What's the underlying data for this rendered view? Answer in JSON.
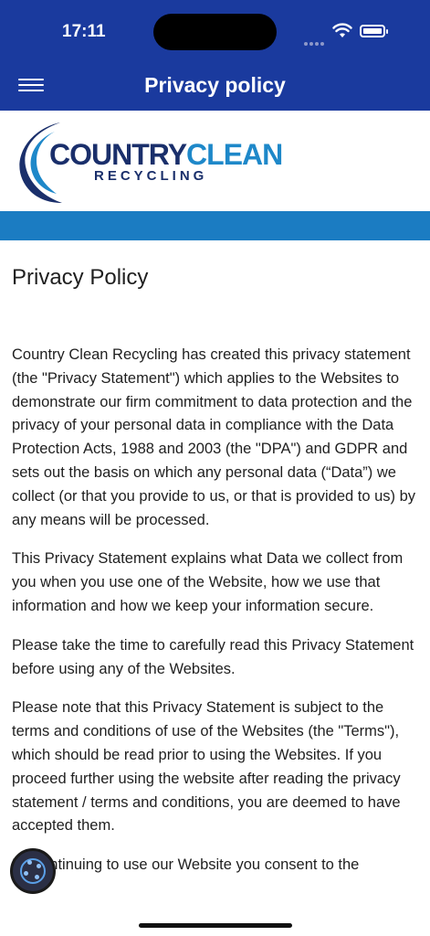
{
  "status_bar": {
    "time": "17:11"
  },
  "header": {
    "title": "Privacy policy"
  },
  "logo": {
    "word1": "COUNTRY",
    "word2": "CLEAN",
    "sub": "RECYCLING"
  },
  "colors": {
    "header": "#1a3a9e",
    "accent_bar": "#1b7cc2",
    "logo_dark": "#1a2f6b",
    "logo_light": "#1e88c9"
  },
  "content": {
    "heading": "Privacy Policy",
    "paragraphs": [
      "Country Clean Recycling has created this privacy statement (the \"Privacy Statement\") which applies to the Websites to demonstrate our firm commitment to data protection and the privacy of your personal data in compliance with the Data Protection Acts, 1988 and 2003 (the \"DPA\") and GDPR and sets out the basis on which any personal data (“Data”) we collect (or that you provide to us, or that is provided to us) by any means will be processed.",
      "This Privacy Statement explains what Data we collect from you when you use one of the Website, how we use that information and how we keep your information secure.",
      "Please take the time to carefully read this Privacy Statement before using any of the Websites.",
      "Please note that this Privacy Statement is subject to the terms and conditions of use of the Websites (the \"Terms\"), which should be read prior to using the Websites.  If you proceed further using the website after reading the privacy statement / terms and conditions, you are deemed to have accepted them.",
      "By continuing to use our Website you consent to the"
    ]
  },
  "icons": {
    "menu": "hamburger-icon",
    "fab": "cookie-settings-icon"
  }
}
